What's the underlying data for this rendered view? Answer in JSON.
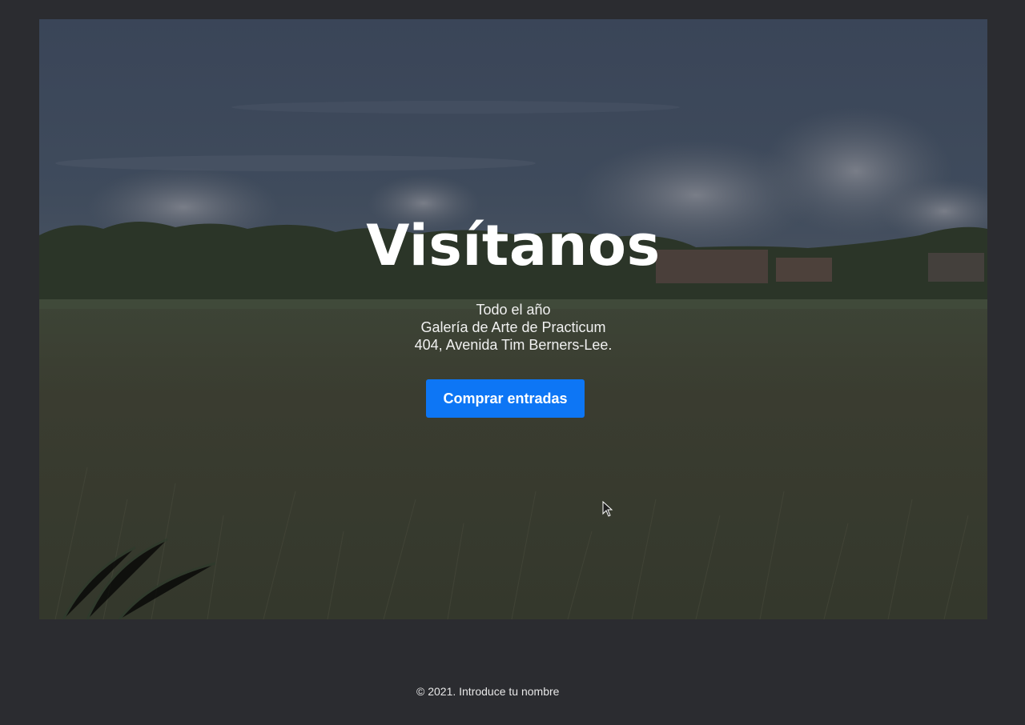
{
  "hero": {
    "title": "Visítanos",
    "lines": [
      "Todo el año",
      "Galería de Arte de Practicum",
      "404, Avenida Tim Berners-Lee."
    ],
    "cta_label": "Comprar entradas",
    "background_image": "landscape-field-photo"
  },
  "footer": {
    "copyright": "© 2021. Introduce tu nombre"
  },
  "colors": {
    "page_background": "#2b2c30",
    "cta_background": "#0d76f5",
    "text": "#ffffff"
  }
}
